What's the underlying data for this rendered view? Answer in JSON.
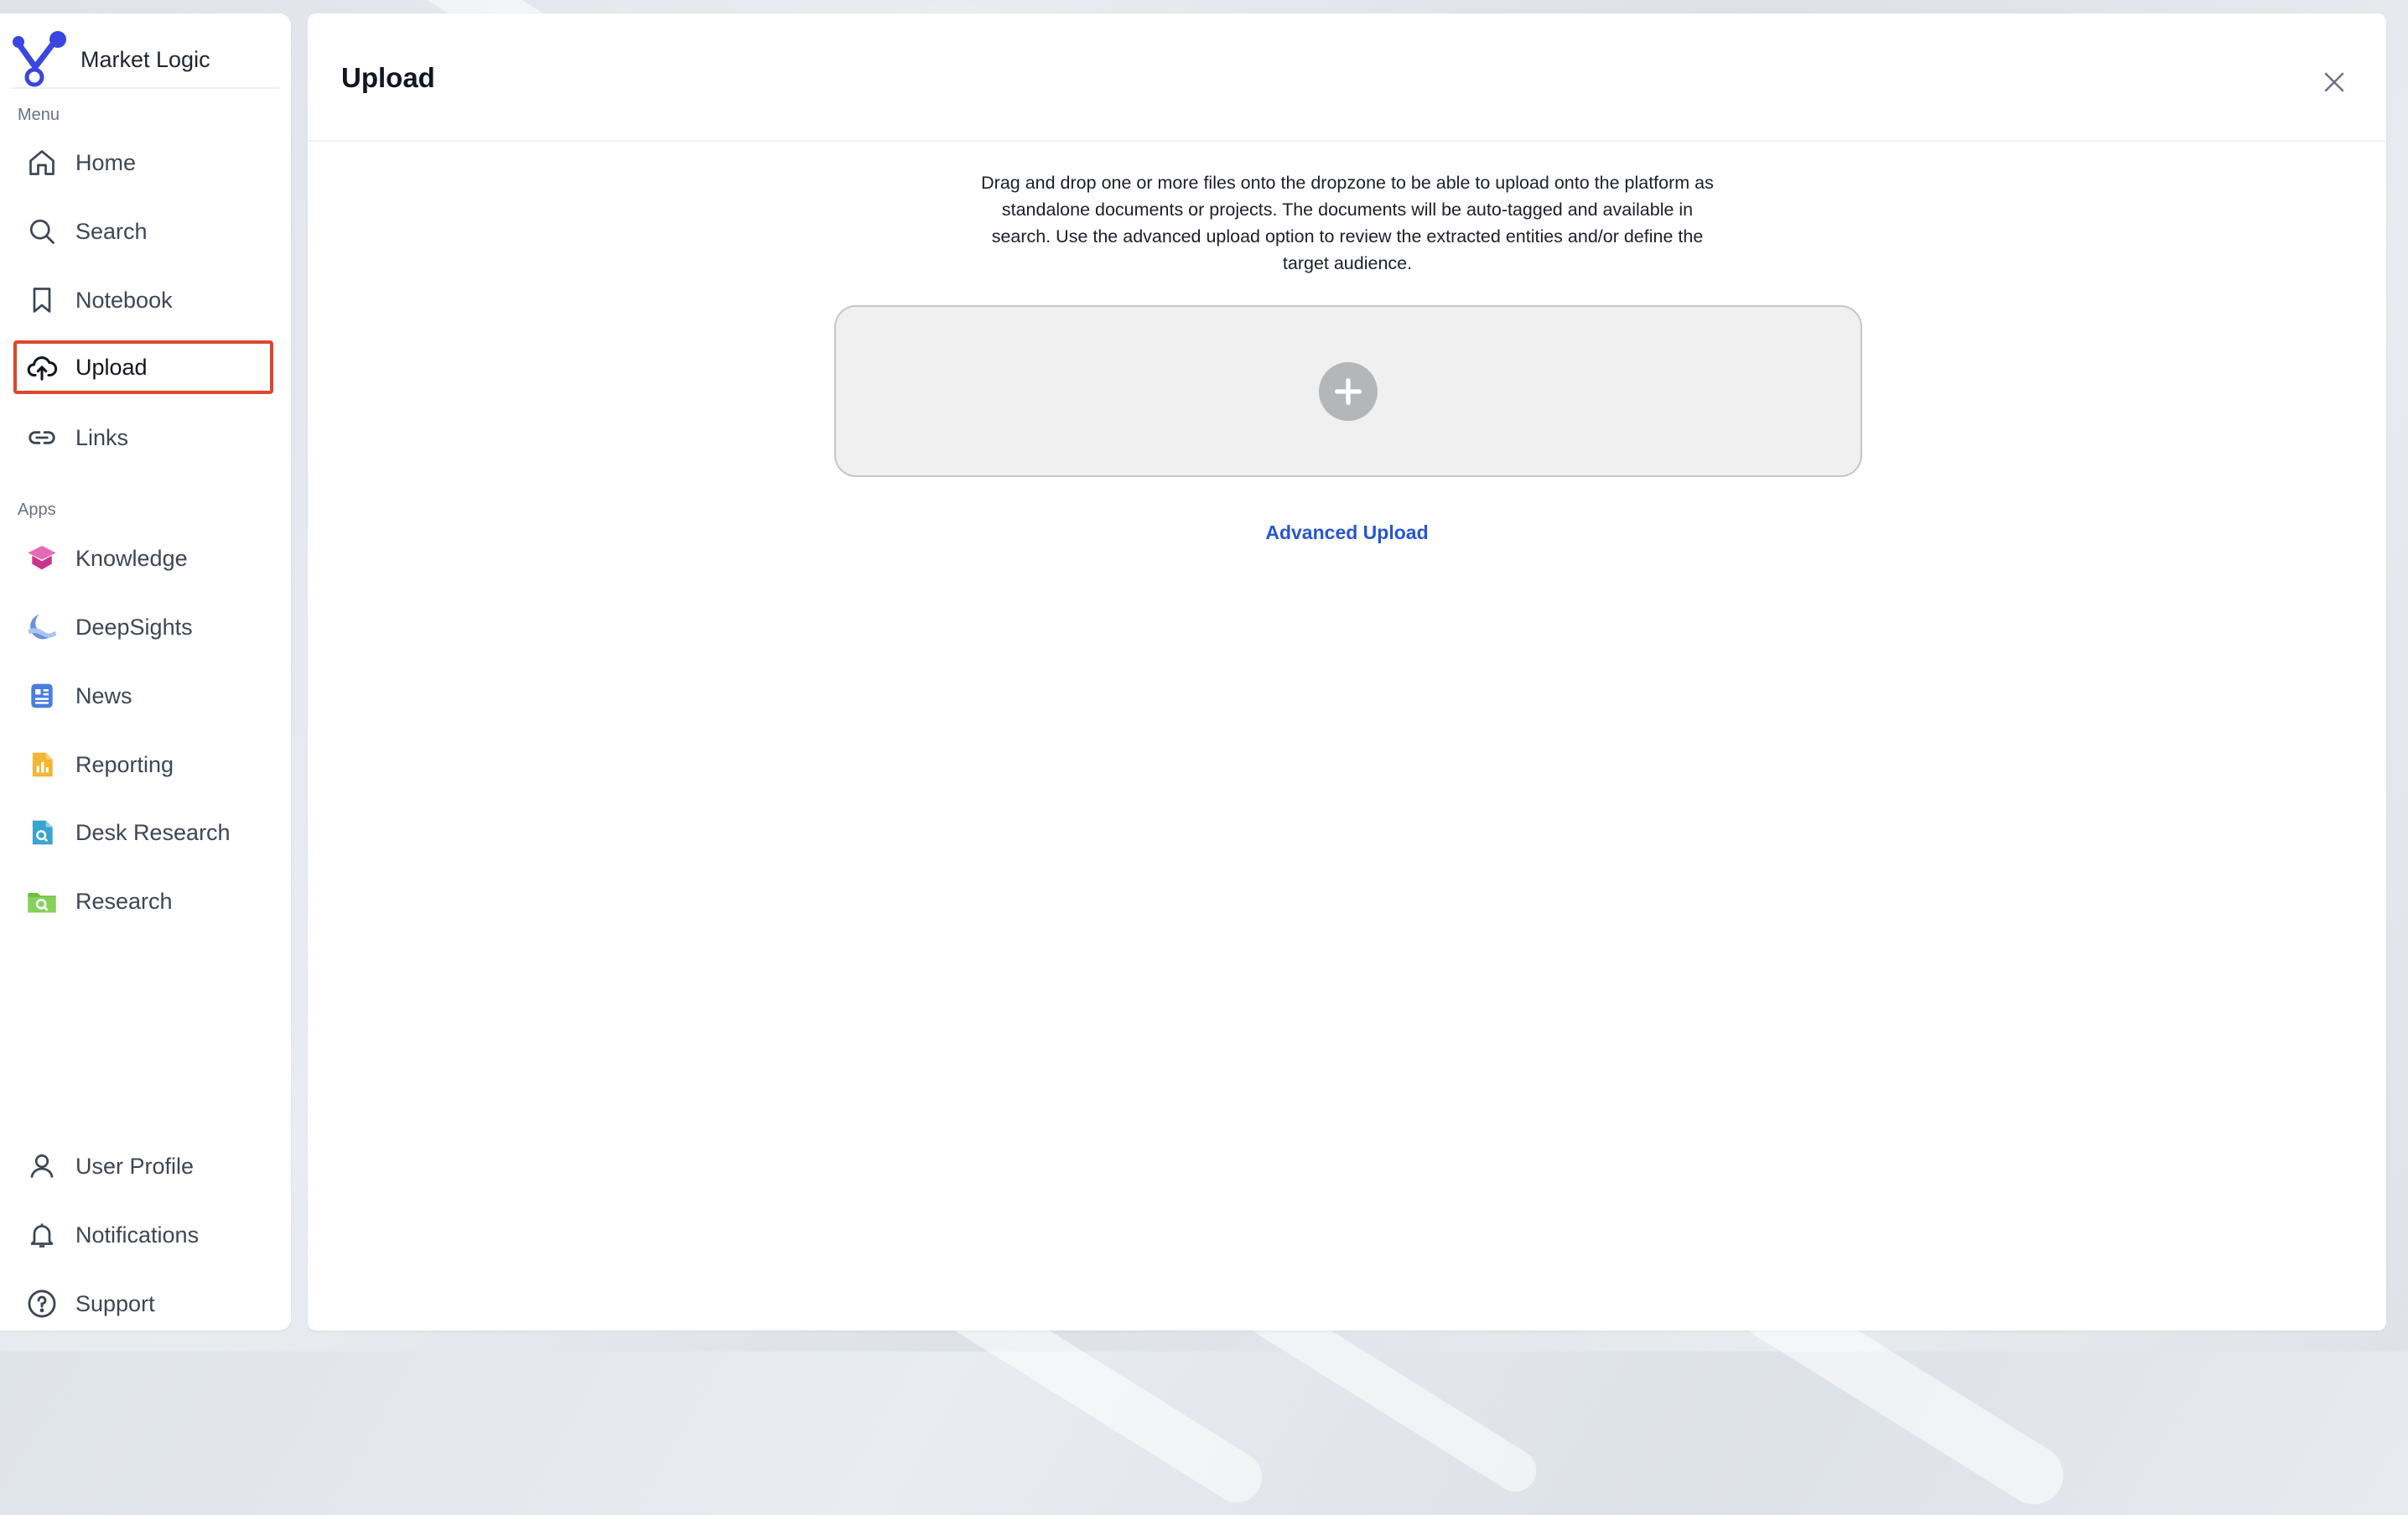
{
  "brand": {
    "name": "Market Logic"
  },
  "sidebar": {
    "menu_label": "Menu",
    "apps_label": "Apps",
    "menu_items": [
      {
        "label": "Home",
        "icon": "home-icon"
      },
      {
        "label": "Search",
        "icon": "search-icon"
      },
      {
        "label": "Notebook",
        "icon": "bookmark-icon"
      },
      {
        "label": "Upload",
        "icon": "cloud-upload-icon",
        "active": true
      },
      {
        "label": "Links",
        "icon": "link-icon"
      }
    ],
    "app_items": [
      {
        "label": "Knowledge",
        "icon": "graduation-cap-icon",
        "color": "#d2449a"
      },
      {
        "label": "DeepSights",
        "icon": "moon-wave-icon",
        "color": "#5b7fd8"
      },
      {
        "label": "News",
        "icon": "newspaper-icon",
        "color": "#4a7de0"
      },
      {
        "label": "Reporting",
        "icon": "bar-chart-document-icon",
        "color": "#f0b130"
      },
      {
        "label": "Desk Research",
        "icon": "document-search-icon",
        "color": "#3aa3cf"
      },
      {
        "label": "Research",
        "icon": "folder-search-icon",
        "color": "#6cbf3f"
      }
    ],
    "bottom_items": [
      {
        "label": "User Profile",
        "icon": "user-icon"
      },
      {
        "label": "Notifications",
        "icon": "bell-icon"
      },
      {
        "label": "Support",
        "icon": "help-circle-icon"
      }
    ]
  },
  "main": {
    "title": "Upload",
    "description": "Drag and drop one or more files onto the dropzone to be able to upload onto the platform as standalone documents or projects. The documents will be auto-tagged and available in search. Use the advanced upload option to review the extracted entities and/or define the target audience.",
    "advanced_upload_label": "Advanced Upload"
  },
  "colors": {
    "accent": "#2856d0",
    "active_outline": "#e0452c",
    "brand": "#3b46e0"
  }
}
